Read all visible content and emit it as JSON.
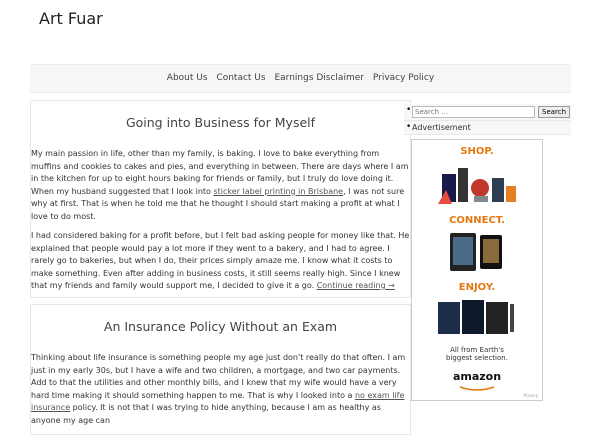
{
  "site": {
    "title": "Art Fuar"
  },
  "nav": [
    {
      "label": "About Us"
    },
    {
      "label": "Contact Us"
    },
    {
      "label": "Earnings Disclaimer"
    },
    {
      "label": "Privacy Policy"
    }
  ],
  "posts": [
    {
      "title": "Going into Business for Myself",
      "paragraphs": [
        {
          "text_before": "My main passion in life, other than my family, is baking. I love to bake everything from muffins and cookies to cakes and pies, and everything in between. There are days where I am in the kitchen for up to eight hours baking for friends or family, but I truly do love doing it. When my husband suggested that I look into ",
          "link": "sticker label printing in Brisbane",
          "text_after": ", I was not sure why at first. That is when he told me that he thought I should start making a profit at what I love to do most."
        },
        {
          "text": "I had considered baking for a profit before, but I felt bad asking people for money like that. He explained that people would pay a lot more if they went to a bakery, and I had to agree. I rarely go to bakeries, but when I do, their prices simply amaze me. I know what it costs to make something. Even after adding in business costs, it still seems really high. Since I knew that my friends and family would support me, I decided to give it a go. ",
          "more": "Continue reading →"
        }
      ]
    },
    {
      "title": "An Insurance Policy Without an Exam",
      "paragraphs": [
        {
          "text_before": "Thinking about life insurance is something people my age just don't really do that often. I am just in my early 30s, but I have a wife and two children, a mortgage, and two car payments. Add to that the utilities and other monthly bills, and I knew that my wife would have a very hard time making it should something happen to me. That is why I looked into a ",
          "link": "no exam life insurance",
          "text_after": " policy. It is not that I was trying to hide anything, because I am as healthy as anyone my age can"
        }
      ]
    }
  ],
  "sidebar": {
    "search_placeholder": "Search …",
    "search_button": "Search",
    "advertisement_label": "Advertisement"
  },
  "ad": {
    "shop": "SHOP.",
    "connect": "CONNECT.",
    "enjoy": "ENJOY.",
    "tagline_1": "All from Earth's",
    "tagline_2": "biggest selection.",
    "brand": "amazon",
    "privacy": "Privacy",
    "colors": {
      "heading": "#e47911"
    }
  }
}
